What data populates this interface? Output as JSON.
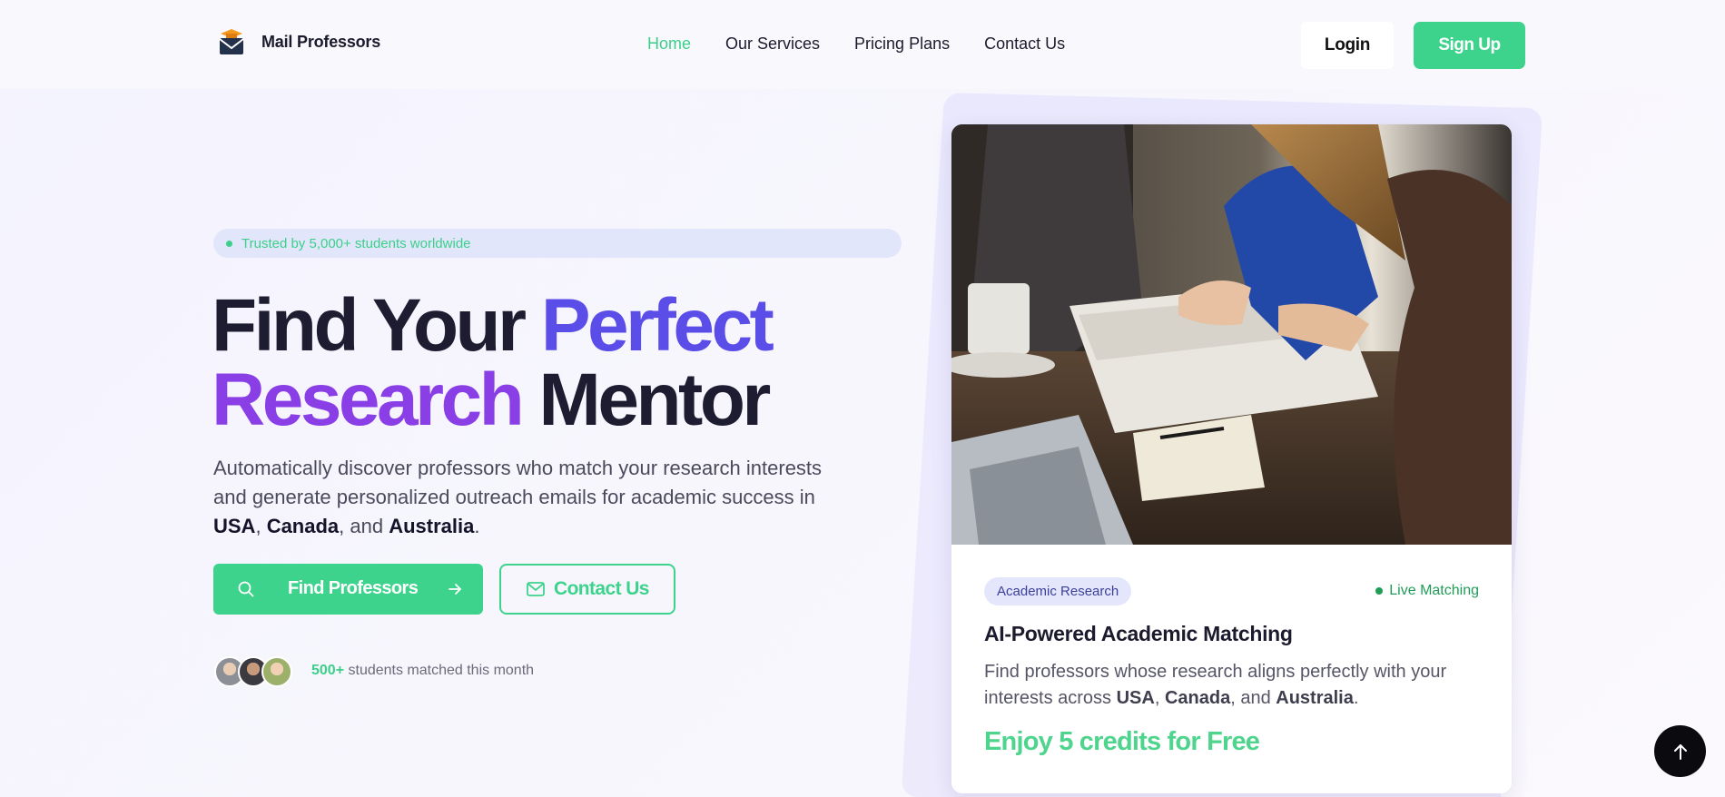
{
  "header": {
    "brand": "Mail Professors",
    "nav": [
      {
        "label": "Home",
        "active": true
      },
      {
        "label": "Our Services",
        "active": false
      },
      {
        "label": "Pricing Plans",
        "active": false
      },
      {
        "label": "Contact Us",
        "active": false
      }
    ],
    "login_label": "Login",
    "signup_label": "Sign Up"
  },
  "hero": {
    "badge": "Trusted by 5,000+ students worldwide",
    "headline_part1": "Find Your ",
    "headline_part2": "Perfect",
    "headline_part3": "Research",
    "headline_part4": " Mentor",
    "subtext_intro": "Automatically discover professors who match your research interests and generate personalized outreach emails for academic success in ",
    "country1": "USA",
    "sep1": ", ",
    "country2": "Canada",
    "sep2": ", and ",
    "country3": "Australia",
    "end": ".",
    "find_button": "Find Professors",
    "contact_button": "Contact Us",
    "matched_count": "500+",
    "matched_text": " students matched this month"
  },
  "card": {
    "tag": "Academic Research",
    "live": "Live Matching",
    "title": "AI-Powered Academic Matching",
    "desc_intro": "Find professors whose research aligns perfectly with your interests across ",
    "country1": "USA",
    "sep1": ", ",
    "country2": "Canada",
    "sep2": ", and ",
    "country3": "Australia",
    "end": ".",
    "credits": "Enjoy 5 credits for Free"
  },
  "colors": {
    "accent_green": "#3dd38c",
    "headline_blue": "#5b4de8",
    "headline_purple": "#8a3ee6"
  },
  "icons": [
    "mail-grad-logo-icon",
    "search-icon",
    "arrow-right-icon",
    "mail-icon",
    "arrow-up-icon"
  ]
}
